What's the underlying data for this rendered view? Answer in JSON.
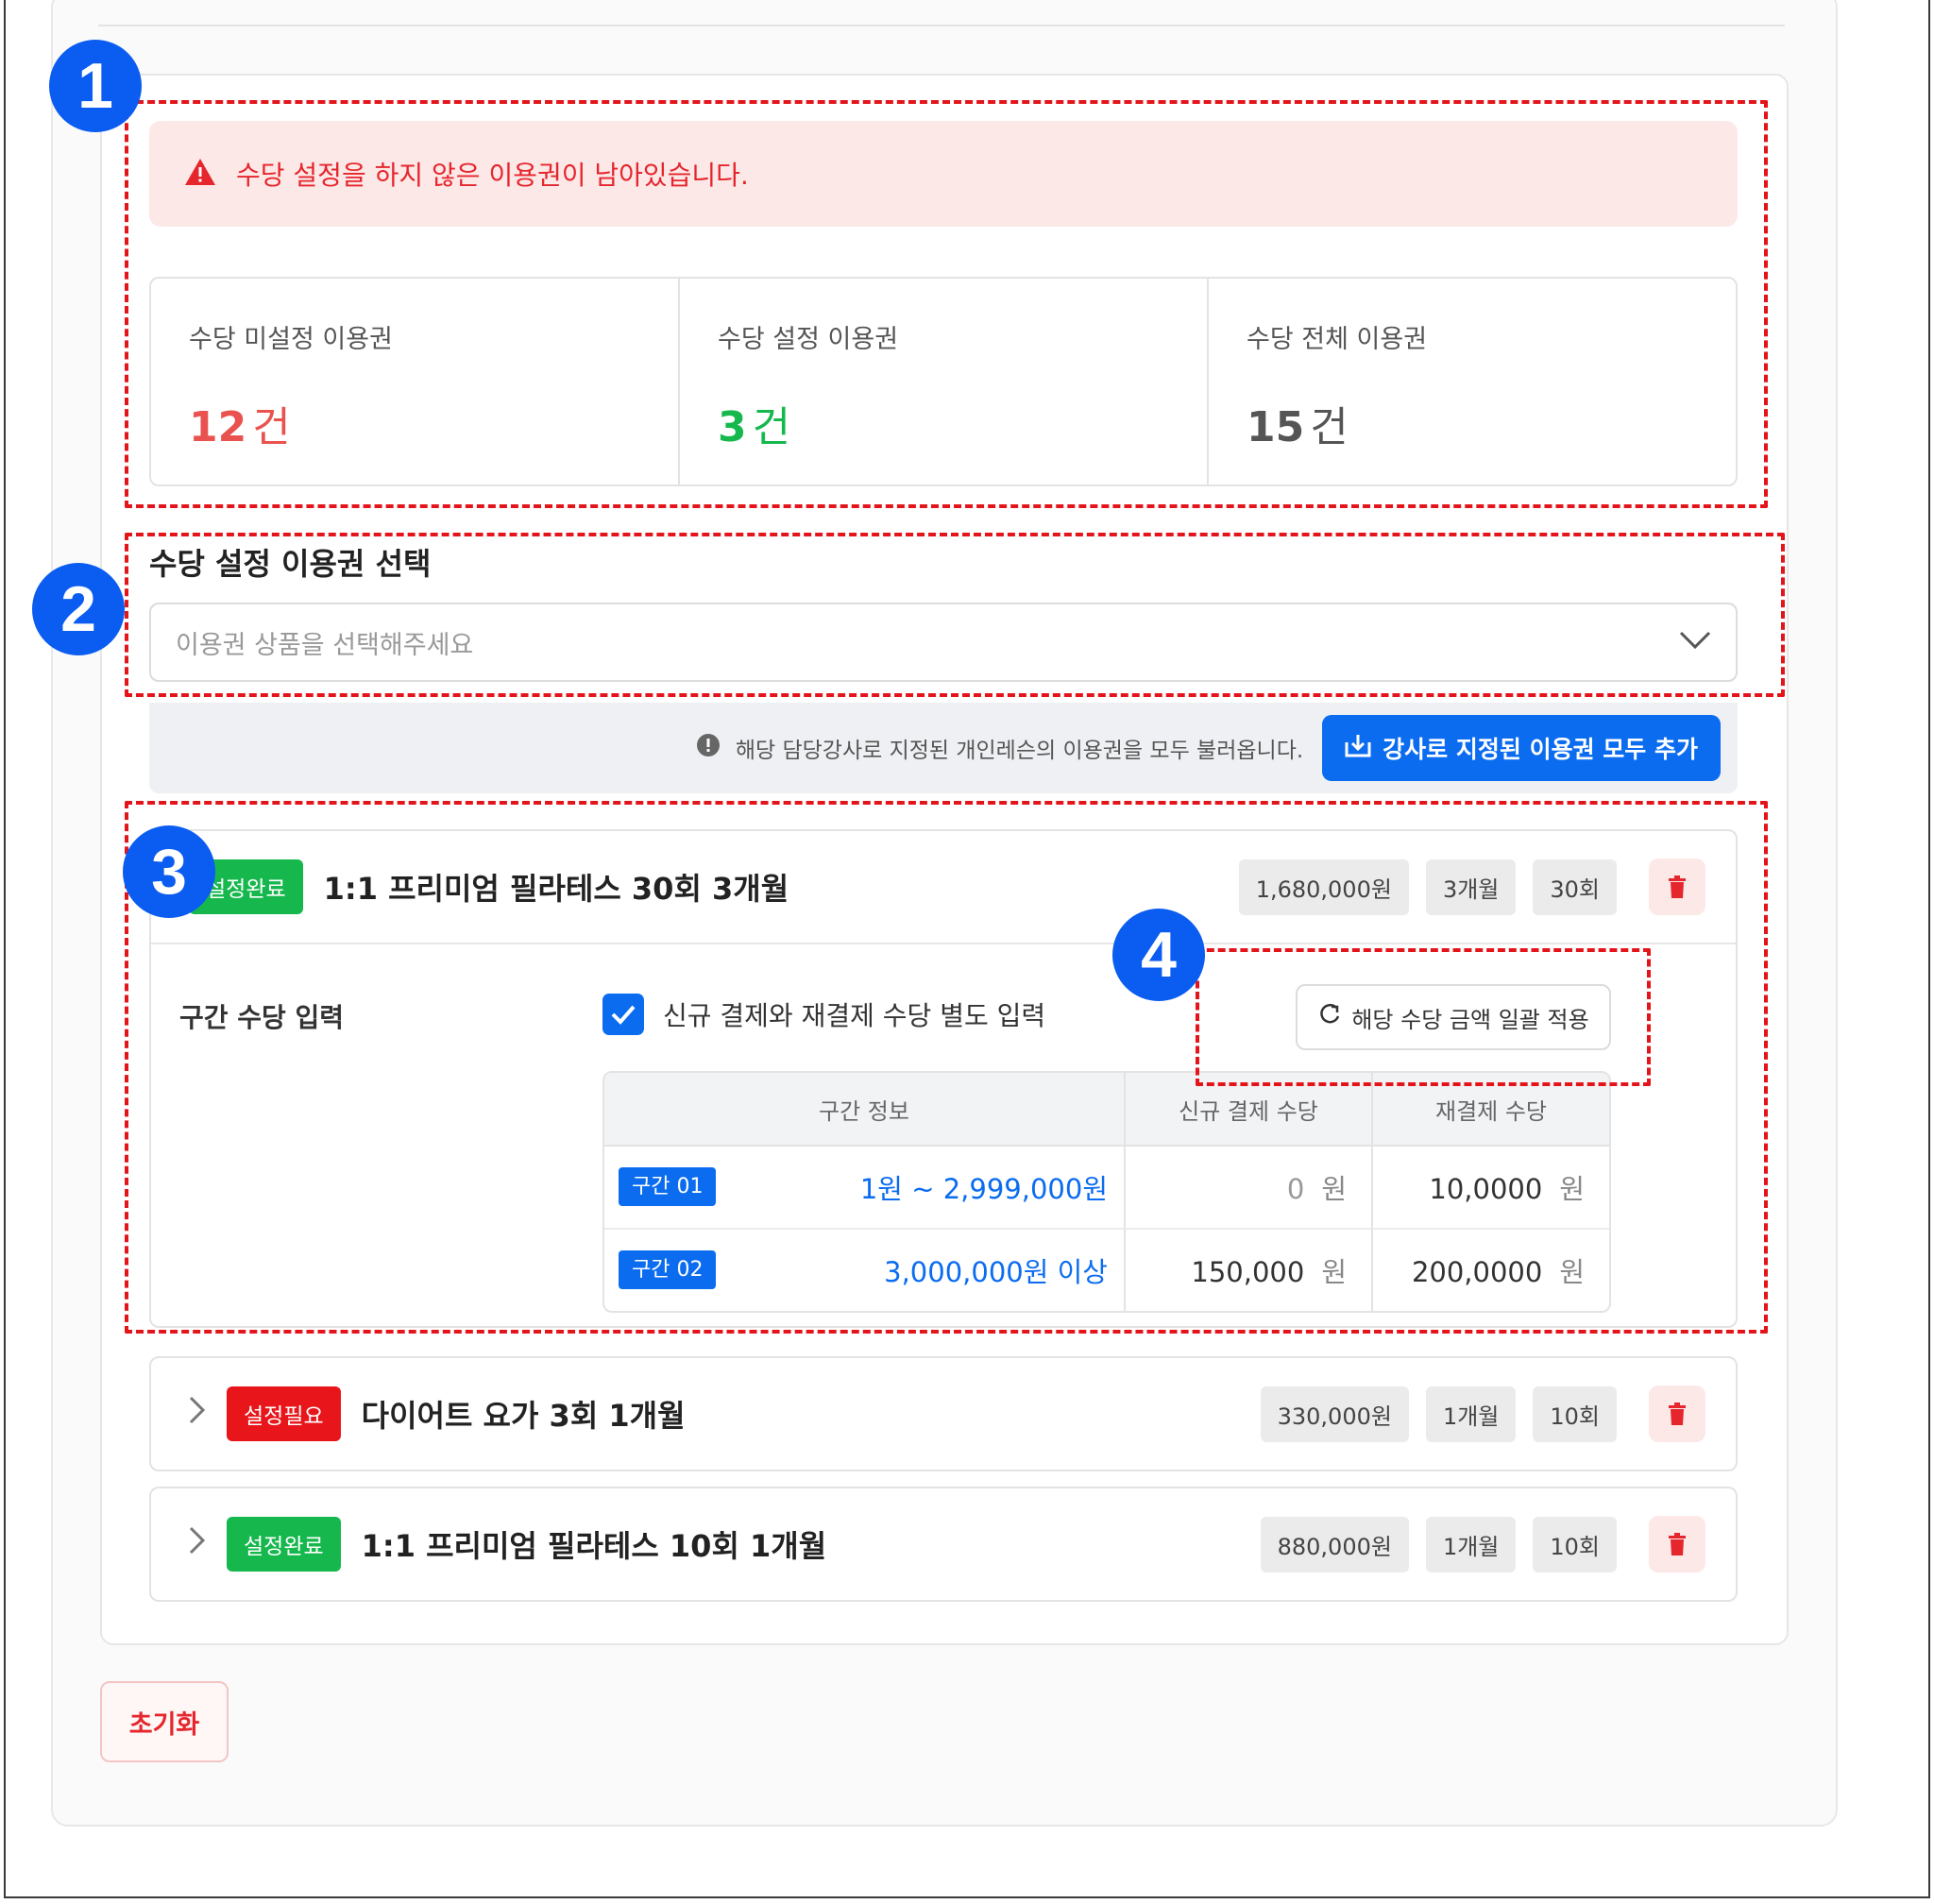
{
  "alert": {
    "message": "수당 설정을 하지 않은 이용권이 남아있습니다."
  },
  "stats": [
    {
      "label": "수당 미설정 이용권",
      "value": "12",
      "unit": "건",
      "color": "#e9524f"
    },
    {
      "label": "수당 설정 이용권",
      "value": "3",
      "unit": "건",
      "color": "#16b84e"
    },
    {
      "label": "수당 전체 이용권",
      "value": "15",
      "unit": "건",
      "color": "#555555"
    }
  ],
  "select": {
    "title": "수당 설정 이용권 선택",
    "placeholder": "이용권 상품을 선택해주세요"
  },
  "load": {
    "info": "해당 담당강사로 지정된 개인레슨의 이용권을 모두 불러옵니다.",
    "button": "강사로 지정된 이용권 모두 추가"
  },
  "tickets": [
    {
      "status": "설정완료",
      "name": "1:1 프리미엄 필라테스 30회 3개월",
      "price": "1,680,000원",
      "period": "3개월",
      "count": "30회"
    },
    {
      "status": "설정필요",
      "name": "다이어트 요가 3회 1개월",
      "price": "330,000원",
      "period": "1개월",
      "count": "10회"
    },
    {
      "status": "설정완료",
      "name": "1:1 프리미엄 필라테스 10회 1개월",
      "price": "880,000원",
      "period": "1개월",
      "count": "10회"
    }
  ],
  "range": {
    "label": "구간 수당 입력",
    "checkbox_label": "신규 결제와 재결제 수당 별도 입력",
    "apply_button": "해당 수당 금액 일괄 적용",
    "headers": [
      "구간 정보",
      "신규 결제 수당",
      "재결제 수당"
    ],
    "rows": [
      {
        "badge": "구간 01",
        "range": "1원  ~  2,999,000원",
        "new": "0",
        "re": "10,0000",
        "unit": "원"
      },
      {
        "badge": "구간 02",
        "range": "3,000,000원  이상",
        "new": "150,000",
        "re": "200,0000",
        "unit": "원"
      }
    ]
  },
  "annotations": [
    "1",
    "2",
    "3",
    "4"
  ],
  "reset_button": "초기화",
  "colors": {
    "primary": "#0b6cf0",
    "danger": "#e5262c",
    "success": "#16b84e"
  }
}
